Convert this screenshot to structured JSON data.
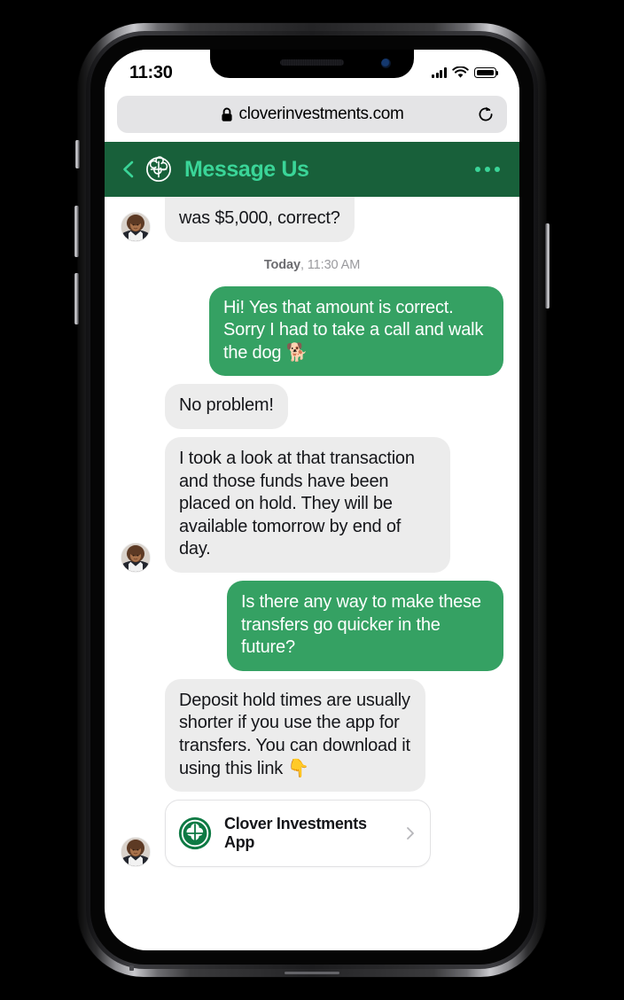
{
  "device": {
    "buttons": [
      "mute-switch",
      "volume-up",
      "volume-down",
      "power"
    ]
  },
  "status_bar": {
    "time": "11:30",
    "signal_icon": "cellular-signal-icon",
    "wifi_icon": "wifi-icon",
    "battery_icon": "battery-icon"
  },
  "browser": {
    "lock_icon": "lock-icon",
    "url": "cloverinvestments.com",
    "reload_icon": "reload-icon"
  },
  "app_header": {
    "back_icon": "back-chevron-icon",
    "logo_icon": "clover-logo-icon",
    "title": "Message Us",
    "menu_icon": "more-options-icon",
    "bg_color": "#18603a",
    "title_color": "#3ad598"
  },
  "thread": {
    "messages": [
      {
        "id": "msg-0",
        "side": "in",
        "text": "was $5,000, correct?",
        "clipped": true,
        "avatar": true,
        "max_width": 300
      },
      {
        "id": "msg-1",
        "side": "out",
        "text": "Hi! Yes that amount is correct. Sorry I had to take a call and walk the dog 🐕",
        "max_width": 300
      },
      {
        "id": "msg-2",
        "side": "in",
        "text": "No problem!",
        "avatar": false,
        "max_width": 300
      },
      {
        "id": "msg-3",
        "side": "in",
        "text": "I took a look at that transaction and those funds have been placed on hold. They will be available tomorrow by end of day.",
        "avatar": true,
        "max_width": 290
      },
      {
        "id": "msg-4",
        "side": "out",
        "text": "Is there any way to make these transfers go quicker in the future?",
        "max_width": 280
      },
      {
        "id": "msg-5",
        "side": "in",
        "text": "Deposit hold times are usually shorter if you use the app for transfers. You can download it using this link 👇",
        "avatar": false,
        "max_width": 262
      }
    ],
    "daystamp": {
      "day": "Today",
      "time": ", 11:30 AM"
    },
    "bubble_in_color": "#ececec",
    "bubble_out_color": "#35a163"
  },
  "link_card": {
    "logo_icon": "clover-app-logo-icon",
    "title": "Clover Investments App",
    "chevron_icon": "chevron-right-icon"
  }
}
